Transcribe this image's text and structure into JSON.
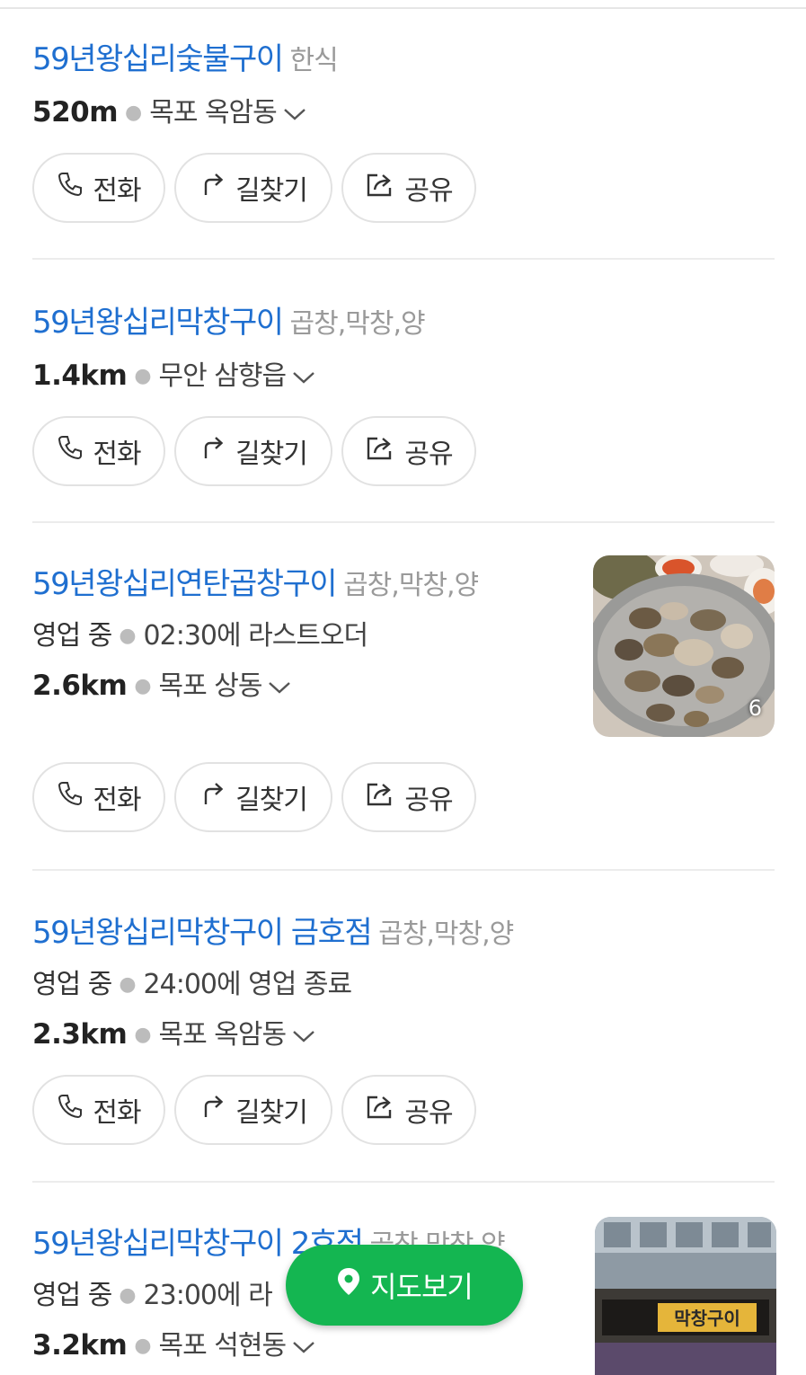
{
  "results": [
    {
      "name": "59년왕십리숯불구이",
      "category": "한식",
      "status": "",
      "hours": "",
      "distance": "520m",
      "area": "목포 옥암동",
      "actions": {
        "call": "전화",
        "route": "길찾기",
        "share": "공유"
      }
    },
    {
      "name": "59년왕십리막창구이",
      "category": "곱창,막창,양",
      "status": "",
      "hours": "",
      "distance": "1.4km",
      "area": "무안 삼향읍",
      "actions": {
        "call": "전화",
        "route": "길찾기",
        "share": "공유"
      }
    },
    {
      "name": "59년왕십리연탄곱창구이",
      "category": "곱창,막창,양",
      "status": "영업 중",
      "hours": "02:30에 라스트오더",
      "distance": "2.6km",
      "area": "목포 상동",
      "photo_count": "6",
      "actions": {
        "call": "전화",
        "route": "길찾기",
        "share": "공유"
      }
    },
    {
      "name": "59년왕십리막창구이 금호점",
      "category": "곱창,막창,양",
      "status": "영업 중",
      "hours": "24:00에 영업 종료",
      "distance": "2.3km",
      "area": "목포 옥암동",
      "actions": {
        "call": "전화",
        "route": "길찾기",
        "share": "공유"
      }
    },
    {
      "name": "59년왕십리막창구이 2호점",
      "category": "곱창,막창,양",
      "status": "영업 중",
      "hours": "23:00에 라",
      "distance": "3.2km",
      "area": "목포 석현동",
      "sign_text": "막창구이"
    }
  ],
  "map_button": {
    "label": "지도보기",
    "color": "#14b651"
  },
  "colors": {
    "link": "#1f6fd0",
    "category": "#9a9a9a",
    "divider": "#ececec"
  },
  "icons": {
    "call": "phone-icon",
    "route": "route-arrow-icon",
    "share": "share-icon",
    "expand": "chevron-down-icon",
    "map": "map-pin-icon"
  }
}
